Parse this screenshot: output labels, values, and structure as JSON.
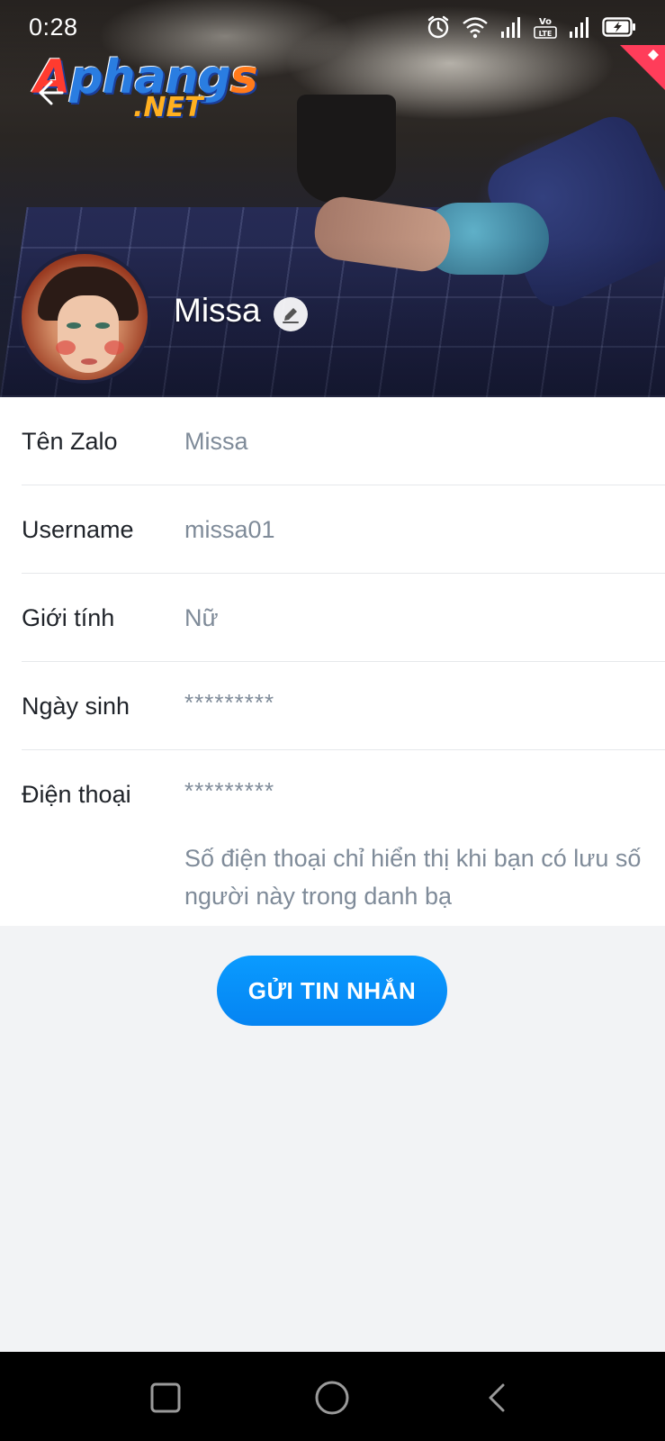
{
  "status_bar": {
    "time": "0:28",
    "icons": [
      "alarm-icon",
      "wifi-icon",
      "signal-icon",
      "volte-icon",
      "signal-icon",
      "battery-charging-icon"
    ],
    "volte_text": "Vo LTE"
  },
  "header": {
    "back_icon": "arrow-left-icon",
    "watermark_main_1": "A",
    "watermark_main_2": "phang",
    "watermark_main_3": "s",
    "watermark_sub": ".NET"
  },
  "profile": {
    "name": "Missa",
    "edit_icon": "pencil-icon"
  },
  "info": {
    "rows": [
      {
        "label": "Tên Zalo",
        "value": "Missa"
      },
      {
        "label": "Username",
        "value": "missa01"
      },
      {
        "label": "Giới tính",
        "value": "Nữ"
      },
      {
        "label": "Ngày sinh",
        "value": "*********"
      },
      {
        "label": "Điện thoại",
        "value": "*********"
      }
    ],
    "phone_note": "Số điện thoại chỉ hiển thị khi bạn có lưu số người này trong danh bạ"
  },
  "actions": {
    "send_message": "GỬI TIN NHẮN"
  },
  "nav": {
    "icons": [
      "recent-apps-icon",
      "home-icon",
      "back-icon"
    ]
  },
  "colors": {
    "primary_button": "#0584f2",
    "label_text": "#1f2329",
    "value_text": "#7f8b99",
    "page_background": "#f2f3f5",
    "ribbon": "#ff3d5a"
  }
}
